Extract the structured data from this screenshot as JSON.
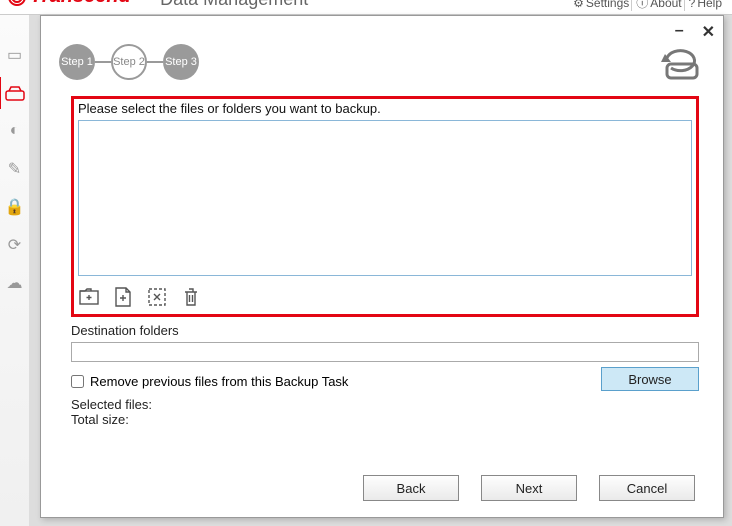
{
  "header": {
    "brand": "Transcend",
    "app_title": "Data Management",
    "links": {
      "settings": "Settings",
      "about": "About",
      "help": "Help"
    }
  },
  "dialog": {
    "steps": {
      "s1": "Step 1",
      "s2": "Step 2",
      "s3": "Step 3"
    },
    "instruction": "Please select the files or folders you want to backup.",
    "dest_label": "Destination folders",
    "remove_prev": "Remove previous files from this Backup Task",
    "browse": "Browse",
    "selected_files": "Selected files:",
    "total_size": "Total size:",
    "buttons": {
      "back": "Back",
      "next": "Next",
      "cancel": "Cancel"
    }
  }
}
